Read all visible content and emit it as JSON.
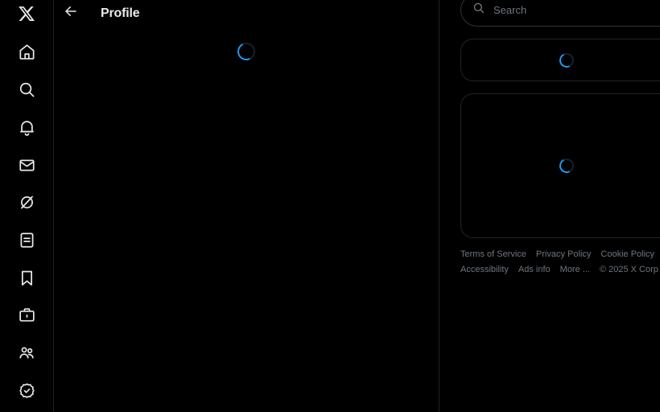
{
  "app": {
    "name": "X",
    "background": "#000000",
    "accent": "#1d9bf0",
    "text_primary": "#e7e9ea",
    "text_muted": "#6e767d",
    "border": "#2f3336"
  },
  "nav_rail": {
    "items": [
      {
        "icon": "x-logo-icon",
        "label": "X"
      },
      {
        "icon": "home-icon",
        "label": "Home"
      },
      {
        "icon": "search-icon",
        "label": "Explore"
      },
      {
        "icon": "bell-icon",
        "label": "Notifications"
      },
      {
        "icon": "envelope-icon",
        "label": "Messages"
      },
      {
        "icon": "grok-icon",
        "label": "Grok"
      },
      {
        "icon": "lists-icon",
        "label": "Lists"
      },
      {
        "icon": "bookmark-icon",
        "label": "Bookmarks"
      },
      {
        "icon": "briefcase-icon",
        "label": "Jobs"
      },
      {
        "icon": "communities-icon",
        "label": "Communities"
      },
      {
        "icon": "verified-badge-icon",
        "label": "Premium"
      }
    ]
  },
  "main": {
    "header": {
      "back_label": "Back",
      "title": "Profile"
    },
    "loading": {
      "status": "Loading"
    }
  },
  "right": {
    "search": {
      "placeholder": "Search",
      "value": ""
    },
    "cards": [
      {
        "status": "Loading"
      },
      {
        "status": "Loading"
      }
    ],
    "footer": {
      "links": [
        "Terms of Service",
        "Privacy Policy",
        "Cookie Policy",
        "Accessibility",
        "Ads info",
        "More ..."
      ],
      "copyright": "© 2025 X Corp"
    }
  }
}
